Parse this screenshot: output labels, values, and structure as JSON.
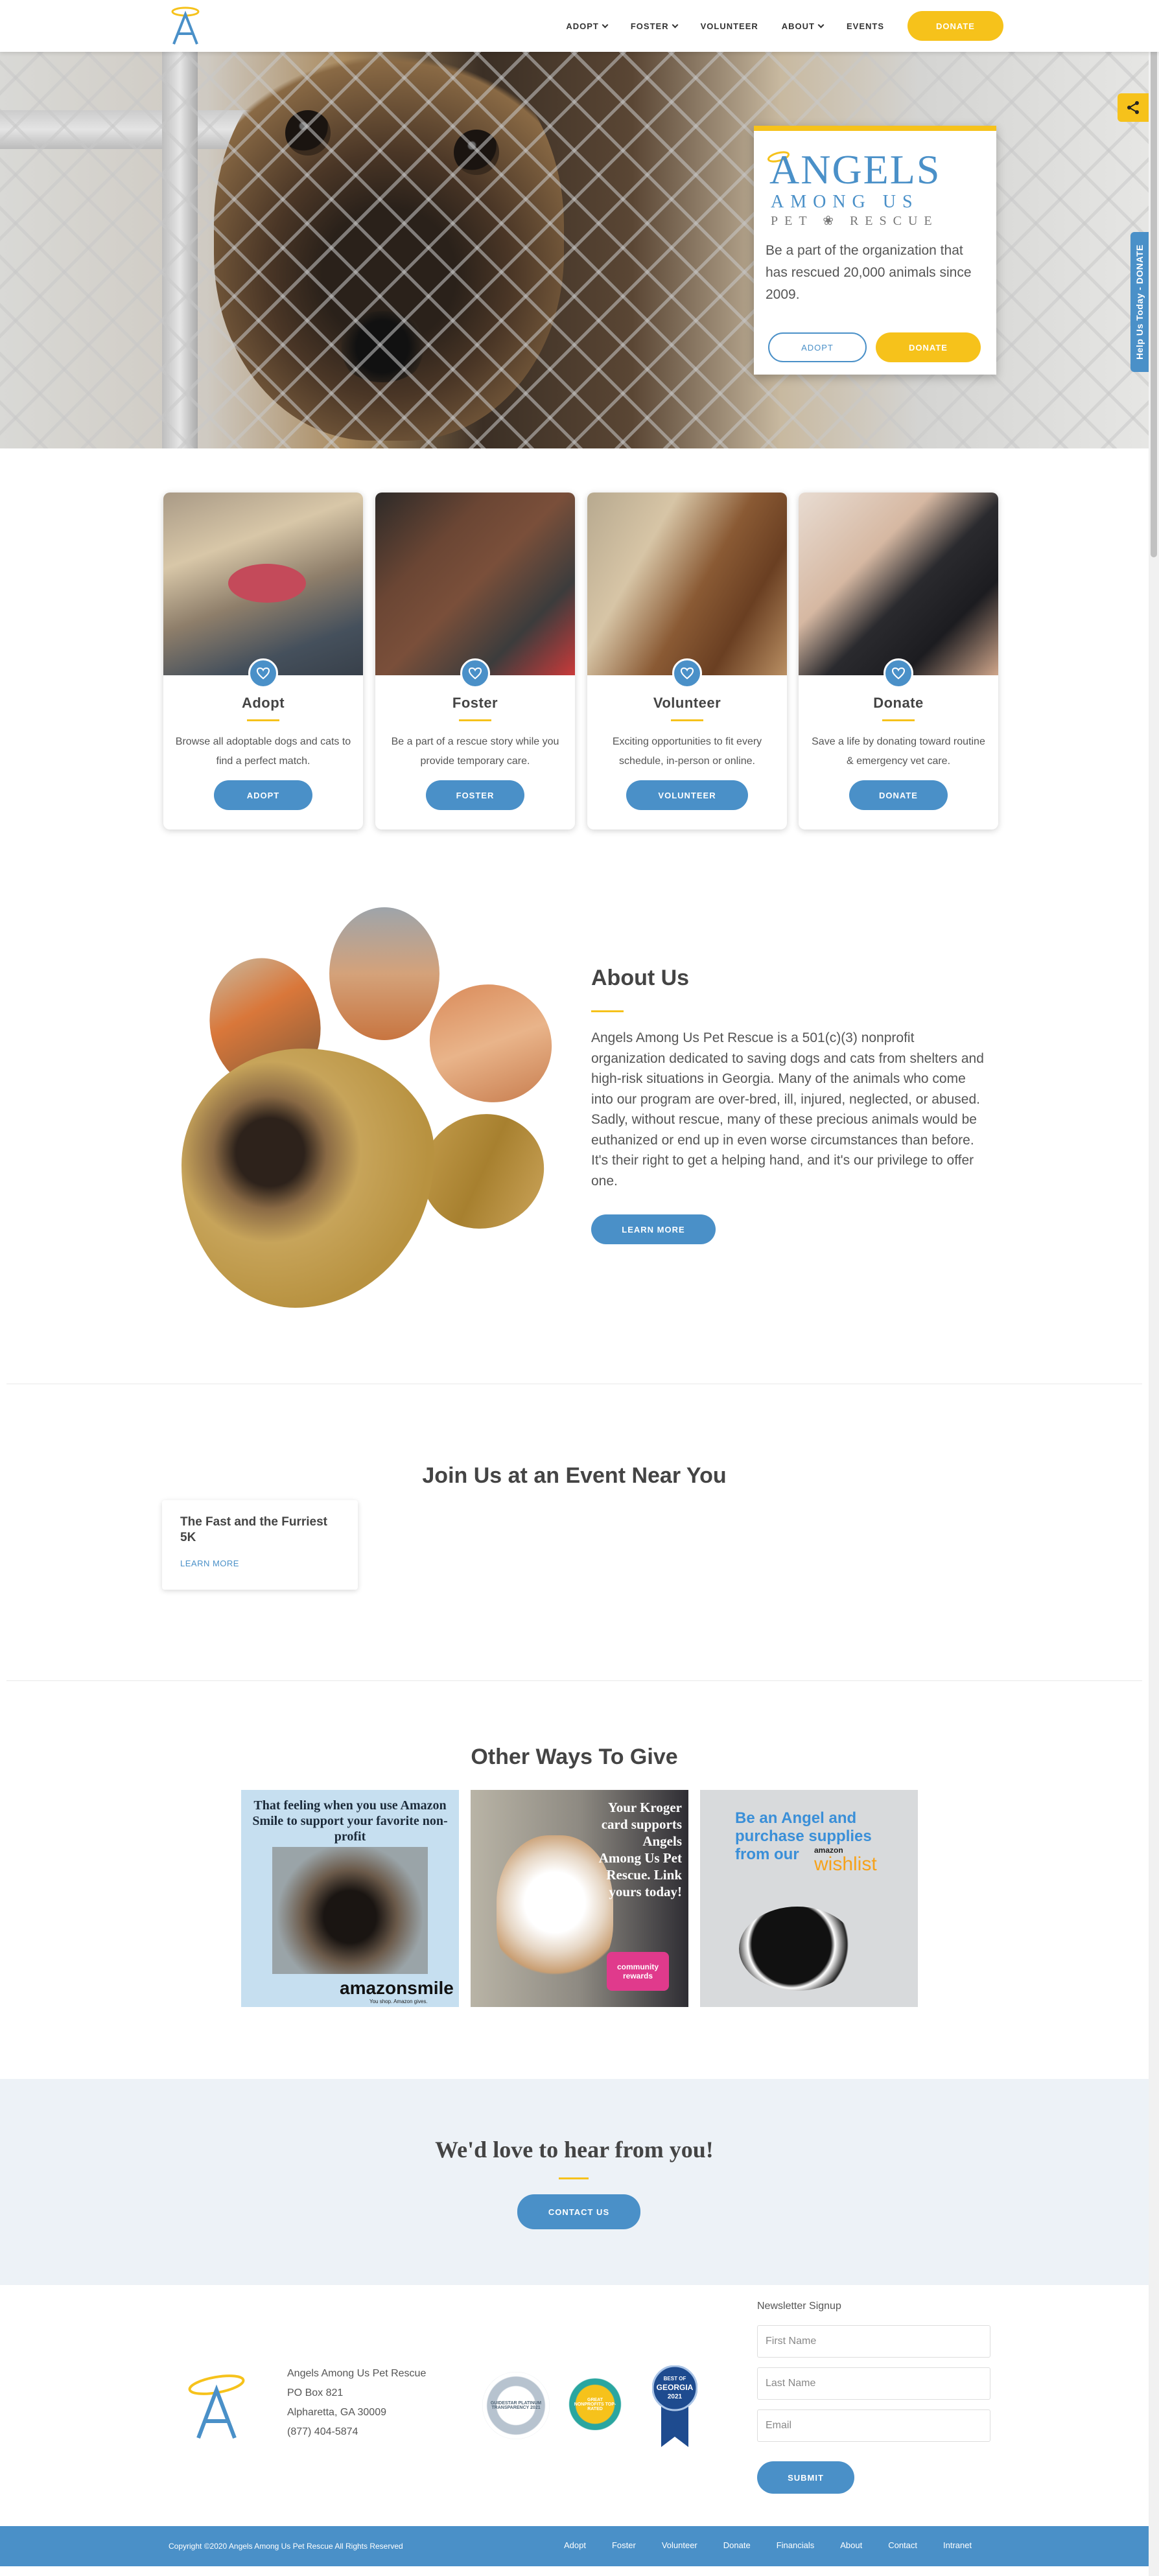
{
  "colors": {
    "accent": "#f6c21b",
    "primary": "#4a90c8",
    "footer_bg": "#4a90c8",
    "contact_bg": "#edf2f7"
  },
  "header": {
    "nav": [
      {
        "label": "ADOPT",
        "dropdown": true
      },
      {
        "label": "FOSTER",
        "dropdown": true
      },
      {
        "label": "VOLUNTEER",
        "dropdown": false
      },
      {
        "label": "ABOUT",
        "dropdown": true
      },
      {
        "label": "EVENTS",
        "dropdown": false
      }
    ],
    "donate_label": "DONATE"
  },
  "hero": {
    "brand_line1": "ANGELS",
    "brand_line2": "AMONG US",
    "brand_line3": "PET ❀ RESCUE",
    "tagline": "Be a part of the organization that has rescued 20,000 animals since 2009.",
    "adopt_label": "ADOPT",
    "donate_label": "DONATE"
  },
  "side_tab": {
    "label": "Help Us Today - DONATE"
  },
  "cards": [
    {
      "title": "Adopt",
      "desc": "Browse all adoptable dogs and cats to find a perfect match.",
      "button": "ADOPT"
    },
    {
      "title": "Foster",
      "desc": "Be a part of a rescue story while you provide temporary care.",
      "button": "FOSTER"
    },
    {
      "title": "Volunteer",
      "desc": "Exciting opportunities to fit every schedule, in-person or online.",
      "button": "VOLUNTEER"
    },
    {
      "title": "Donate",
      "desc": "Save a life by donating toward routine & emergency vet care.",
      "button": "DONATE"
    }
  ],
  "about": {
    "title": "About Us",
    "body": "Angels Among Us Pet Rescue is a 501(c)(3) nonprofit organization dedicated to saving dogs and cats from shelters and high-risk situations in Georgia. Many of the animals who come into our program are over-bred, ill, injured, neglected, or abused. Sadly, without rescue, many of these precious animals would be euthanized or end up in even worse circumstances than before. It's their right to get a helping hand, and it's our privilege to offer one.",
    "button": "LEARN MORE"
  },
  "events": {
    "title": "Join Us at an Event Near You",
    "items": [
      {
        "name": "The Fast and the Furriest 5K",
        "link": "LEARN MORE"
      }
    ]
  },
  "give": {
    "title": "Other Ways To Give",
    "amazon_text": "That feeling when you use Amazon Smile to support your favorite non-profit",
    "amazon_logo": "amazonsmile",
    "amazon_sub": "You shop. Amazon gives.",
    "kroger_text": "Your Kroger card supports Angels Among Us Pet Rescue. Link yours today!",
    "kroger_badge": "community rewards",
    "wishlist_text": "Be an Angel and purchase supplies from our",
    "wishlist_amazon": "amazon",
    "wishlist_word": "wishlist"
  },
  "contact": {
    "title": "We'd love to hear from you!",
    "button": "CONTACT US"
  },
  "footer": {
    "org_name": "Angels Among Us Pet Rescue",
    "po_box": "PO Box 821",
    "city": "Alpharetta, GA 30009",
    "phone": "(877) 404-5874",
    "badge1": "GUIDESTAR PLATINUM TRANSPARENCY 2021",
    "badge2": "GREAT NONPROFITS TOP-RATED",
    "badge3_line1": "BEST OF",
    "badge3_line2": "GEORGIA",
    "badge3_line3": "2021",
    "newsletter_label": "Newsletter Signup",
    "first_name_placeholder": "First Name",
    "last_name_placeholder": "Last Name",
    "email_placeholder": "Email",
    "submit": "SUBMIT",
    "copyright": "Copyright ©2020 Angels Among Us Pet Rescue All Rights Reserved",
    "links": [
      "Adopt",
      "Foster",
      "Volunteer",
      "Donate",
      "Financials",
      "About",
      "Contact",
      "Intranet"
    ]
  }
}
